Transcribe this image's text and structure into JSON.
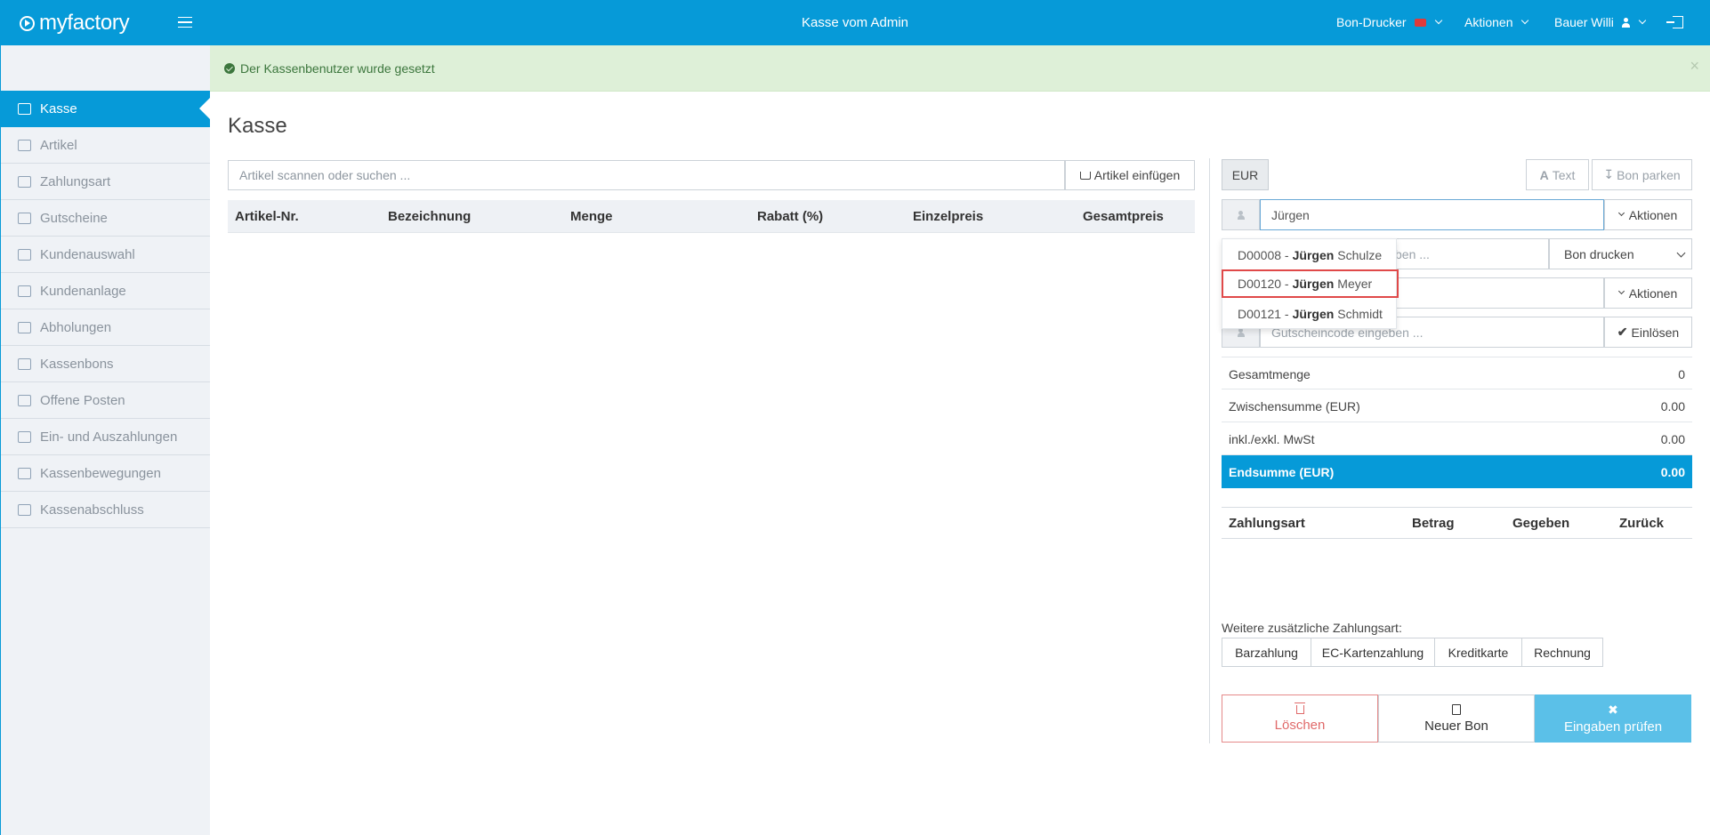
{
  "app": {
    "logo": "myfactory",
    "window_title": "Kasse vom Admin"
  },
  "topbar": {
    "printer_menu": "Bon-Drucker",
    "actions_menu": "Aktionen",
    "user_menu": "Bauer Willi"
  },
  "alert": {
    "message": "Der Kassenbenutzer wurde gesetzt",
    "close": "×"
  },
  "sidebar": {
    "items": [
      {
        "label": "Kasse",
        "icon": "cart-icon",
        "active": true
      },
      {
        "label": "Artikel",
        "icon": "tag-icon"
      },
      {
        "label": "Zahlungsart",
        "icon": "wallet-icon"
      },
      {
        "label": "Gutscheine",
        "icon": "gift-icon"
      },
      {
        "label": "Kundenauswahl",
        "icon": "users-icon"
      },
      {
        "label": "Kundenanlage",
        "icon": "user-add-icon"
      },
      {
        "label": "Abholungen",
        "icon": "cart-icon"
      },
      {
        "label": "Kassenbons",
        "icon": "receipts-icon"
      },
      {
        "label": "Offene Posten",
        "icon": "book-icon"
      },
      {
        "label": "Ein- und Auszahlungen",
        "icon": "inbox-icon"
      },
      {
        "label": "Kassenbewegungen",
        "icon": "list-icon"
      },
      {
        "label": "Kassenabschluss",
        "icon": "calculator-icon"
      }
    ]
  },
  "main": {
    "title": "Kasse",
    "search_placeholder": "Artikel scannen oder suchen ...",
    "add_article_label": "Artikel einfügen",
    "columns": [
      "Artikel-Nr.",
      "Bezeichnung",
      "Menge",
      "Rabatt (%)",
      "Einzelpreis",
      "Gesamtpreis"
    ]
  },
  "panel": {
    "currency": "EUR",
    "text_button": "Text",
    "park_button": "Bon parken",
    "customer_value": "Jürgen",
    "customer_actions": "Aktionen",
    "second_field_tail": "ben ...",
    "print_select": "Bon drucken",
    "third_actions": "Aktionen",
    "voucher_placeholder": "Gutscheincode eingeben ...",
    "redeem_button": "Einlösen",
    "autocomplete": [
      {
        "code": "D00008",
        "first": "Jürgen",
        "last": "Schulze"
      },
      {
        "code": "D00120",
        "first": "Jürgen",
        "last": "Meyer"
      },
      {
        "code": "D00121",
        "first": "Jürgen",
        "last": "Schmidt"
      }
    ],
    "totals": [
      {
        "label": "Gesamtmenge",
        "value": "0"
      },
      {
        "label": "Zwischensumme (EUR)",
        "value": "0.00"
      },
      {
        "label": "inkl./exkl. MwSt",
        "value": "0.00"
      },
      {
        "label": "Endsumme (EUR)",
        "value": "0.00"
      }
    ],
    "payment_columns": [
      "Zahlungsart",
      "Betrag",
      "Gegeben",
      "Zurück"
    ],
    "more_payment_label": "Weitere zusätzliche Zahlungsart:",
    "payment_methods": [
      "Barzahlung",
      "EC-Kartenzahlung",
      "Kreditkarte",
      "Rechnung"
    ],
    "actions": {
      "delete": "Löschen",
      "new_receipt": "Neuer Bon",
      "check": "Eingaben prüfen"
    }
  },
  "colors": {
    "brand": "#069ad8",
    "success_bg": "#def0d8",
    "danger": "#e06a6a",
    "check_bg": "#5bc0e8"
  }
}
